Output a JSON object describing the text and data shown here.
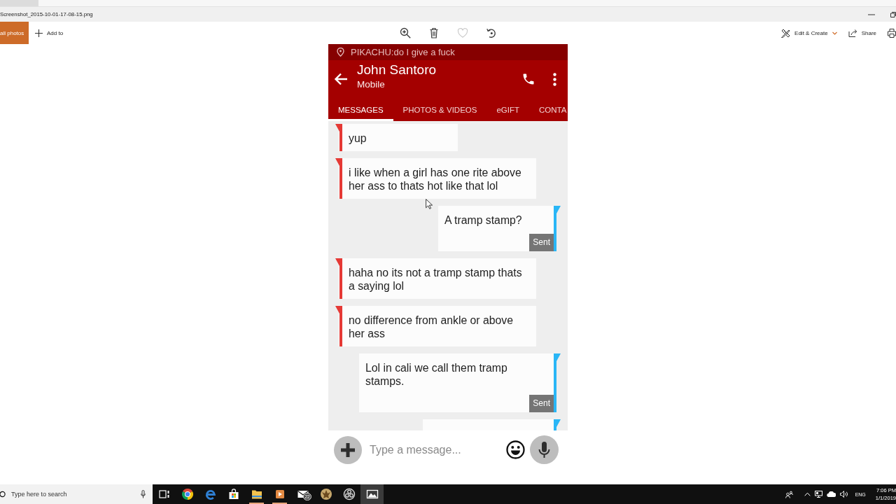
{
  "window": {
    "title": "Screenshot_2015-10-01-17-08-15.png"
  },
  "toolbar": {
    "nav_button": "all photos",
    "add_button": "Add to",
    "actions": [
      {
        "kind": "zoom",
        "disabled": false
      },
      {
        "kind": "delete",
        "disabled": false
      },
      {
        "kind": "favorite",
        "disabled": true
      },
      {
        "kind": "rotate",
        "disabled": false
      }
    ],
    "edit_button": "Edit & Create",
    "share_button": "Share"
  },
  "phone": {
    "notification": "PIKACHU:do I give a fuck",
    "contact": {
      "name": "John Santoro",
      "subtitle": "Mobile"
    },
    "tabs": [
      {
        "label": "MESSAGES",
        "selected": true
      },
      {
        "label": "PHOTOS & VIDEOS",
        "selected": false
      },
      {
        "label": "eGIFT",
        "selected": false
      },
      {
        "label": "CONTA",
        "selected": false
      }
    ],
    "messages": [
      {
        "kind": "received",
        "text": "yup"
      },
      {
        "kind": "received",
        "text": "i like when a girl has one rite above her ass to thats hot like that lol"
      },
      {
        "kind": "sent",
        "text": "A tramp stamp?",
        "status": "Sent"
      },
      {
        "kind": "received",
        "text": "haha no its not a tramp stamp thats a saying lol"
      },
      {
        "kind": "received",
        "text": "no difference from ankle or above her ass"
      },
      {
        "kind": "sent",
        "text": "Lol in cali we call them tramp stamps.",
        "status": "Sent"
      },
      {
        "kind": "sent"
      }
    ],
    "composer": {
      "placeholder": "Type a message..."
    }
  },
  "taskbar": {
    "search": {
      "placeholder": "Type here to search"
    },
    "apps": [
      {
        "kind": "taskview",
        "running": false,
        "active": false
      },
      {
        "kind": "chrome",
        "running": false,
        "active": false
      },
      {
        "kind": "edge",
        "running": false,
        "active": false
      },
      {
        "kind": "store",
        "running": false,
        "active": false
      },
      {
        "kind": "explorer",
        "running": true,
        "active": false
      },
      {
        "kind": "media",
        "running": true,
        "active": false
      },
      {
        "kind": "mail",
        "badge": "22",
        "running": false,
        "active": false
      },
      {
        "kind": "emblem",
        "running": false,
        "active": false
      },
      {
        "kind": "swirl",
        "running": false,
        "active": false
      },
      {
        "kind": "photos",
        "running": false,
        "active": true
      }
    ],
    "tray": {
      "language": "ENG",
      "time": "7:06 PM",
      "date": "1/1/2019"
    }
  }
}
